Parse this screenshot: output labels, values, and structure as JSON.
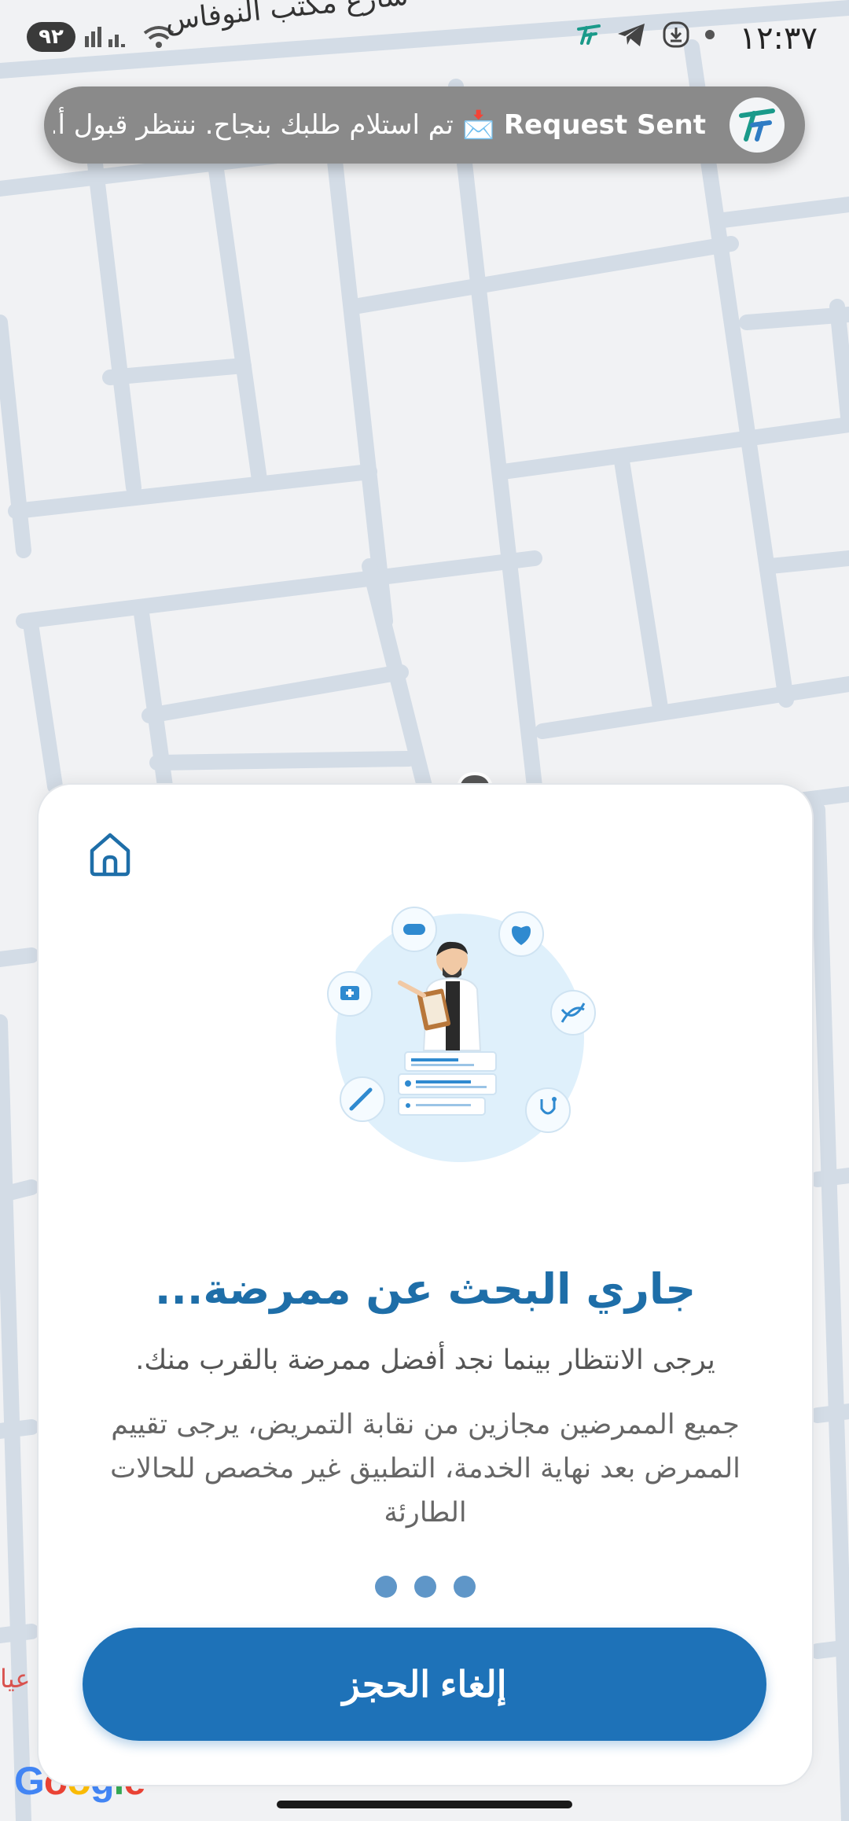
{
  "status_bar": {
    "time": "١٢:٣٧",
    "battery": "٩٢",
    "street_name": "شارع مكتب النوفاس"
  },
  "notification": {
    "title": "Request Sent",
    "emoji": "📩",
    "message": "تم استلام طلبك بنجاح. ننتظر قبول أ..."
  },
  "card": {
    "title": "جاري البحث عن ممرضة...",
    "subtitle": "يرجى الانتظار بينما نجد أفضل ممرضة بالقرب منك.",
    "note": "جميع الممرضين مجازين من نقابة التمريض، يرجى تقييم الممرض بعد نهاية الخدمة، التطبيق غير مخصص للحالات الطارئة",
    "cancel_label": "إلغاء الحجز"
  },
  "map": {
    "attribution": "Google",
    "side_label": "عيا"
  },
  "colors": {
    "primary": "#1e72b8",
    "title": "#1e6ea8",
    "road": "#d3dce6",
    "map_bg": "#f1f2f4"
  }
}
